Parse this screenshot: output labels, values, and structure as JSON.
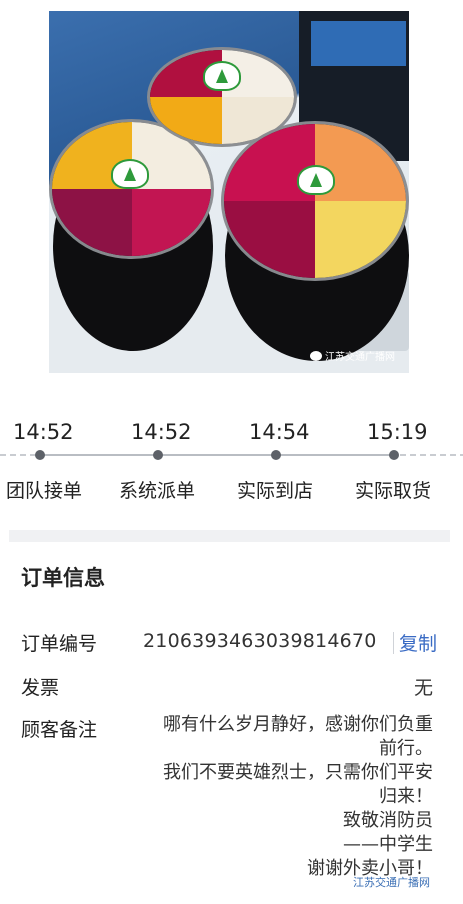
{
  "photo": {
    "watermark": "江苏交通广播网",
    "alt": "fruit-cups-photo"
  },
  "timeline": {
    "steps": [
      {
        "time": "14:52",
        "label": "团队接单"
      },
      {
        "time": "14:52",
        "label": "系统派单"
      },
      {
        "time": "14:54",
        "label": "实际到店"
      },
      {
        "time": "15:19",
        "label": "实际取货"
      }
    ]
  },
  "order": {
    "title": "订单信息",
    "order_number_label": "订单编号",
    "order_number": "2106393463039814670",
    "copy_label": "复制",
    "invoice_label": "发票",
    "invoice_value": "无",
    "remarks_label": "顾客备注",
    "remarks_lines": [
      "哪有什么岁月静好，感谢你们负重",
      "前行。",
      "我们不要英雄烈士，只需你们平安",
      "归来！",
      "致敬消防员",
      "——中学生",
      "谢谢外卖小哥！"
    ]
  },
  "bottom_watermark": "江苏交通广播网",
  "colors": {
    "link": "#3a6bc4",
    "dot": "#5d6168",
    "divider": "#f0f1f3"
  }
}
